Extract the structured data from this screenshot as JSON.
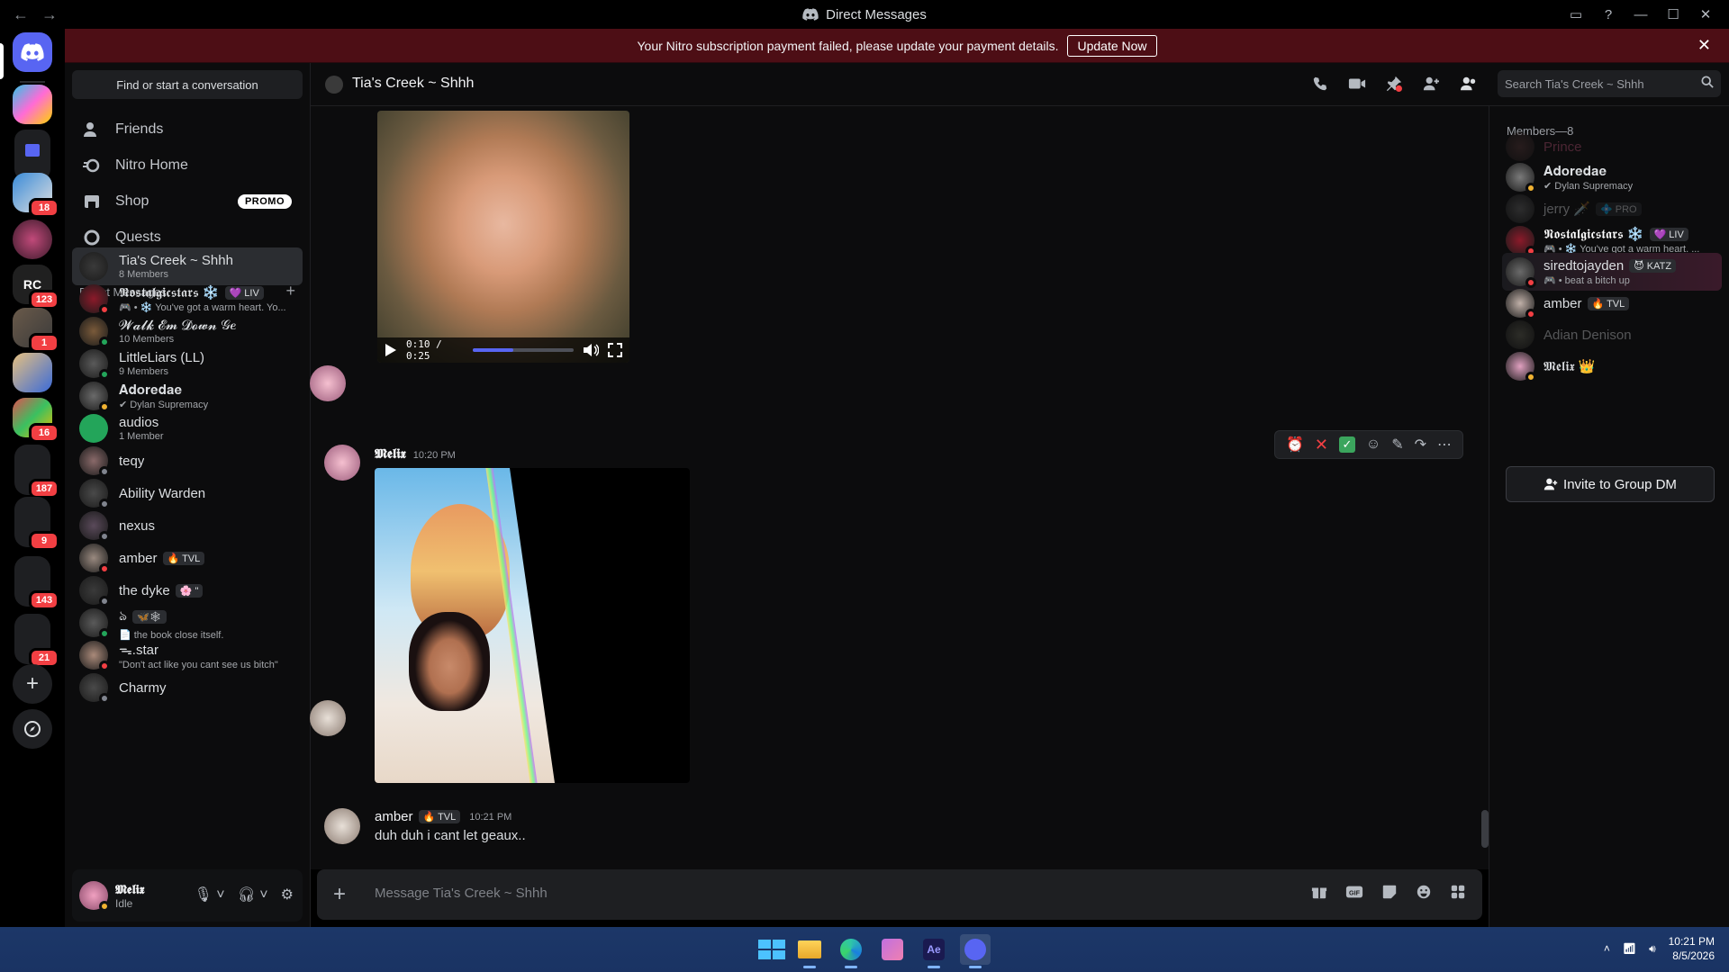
{
  "window": {
    "title": "Direct Messages"
  },
  "banner": {
    "text": "Your Nitro subscription payment failed, please update your payment details.",
    "button": "Update Now"
  },
  "servers": [
    {
      "badge": "18"
    },
    {
      "badge": ""
    },
    {
      "badge": "123"
    },
    {
      "badge": "1"
    },
    {
      "badge": ""
    },
    {
      "badge": "16"
    },
    {
      "badge": "187"
    },
    {
      "badge": "9"
    },
    {
      "badge": "143"
    },
    {
      "badge": "21"
    }
  ],
  "sidebar": {
    "find_placeholder": "Find or start a conversation",
    "nav": [
      {
        "label": "Friends"
      },
      {
        "label": "Nitro Home"
      },
      {
        "label": "Shop",
        "badge": "PROMO"
      },
      {
        "label": "Quests"
      }
    ],
    "dm_header": "Direct Messages",
    "dms": [
      {
        "name": "Tia's Creek ~ Shhh",
        "sub": "8 Members",
        "color": "#3a3a3a"
      },
      {
        "name": "𝕹𝖔𝖘𝖙𝖆𝖑𝖌𝖎𝖈𝖘𝖙𝖆𝖗𝖘 ❄️",
        "tag": "💜 LIV",
        "sub": "🎮 • ❄️ You've got a warm heart. Yo...",
        "color": "#8c1a2a"
      },
      {
        "name": "𝓦𝓪𝓵𝓴 𝓔𝓶 𝓓𝓸𝔀𝓷 𝒢𝒆",
        "sub": "10 Members",
        "color": "#7a5a3a"
      },
      {
        "name": "LittleLiars (LL)",
        "sub": "9 Members",
        "color": "#5a5a5a"
      },
      {
        "name": "𝐀𝐝𝐨𝐫𝐞𝐝𝐚𝐞",
        "sub": "✔ Dylan Supremacy",
        "color": "#6a6a6a"
      },
      {
        "name": "audios",
        "sub": "1 Member",
        "color": "#23a55a"
      },
      {
        "name": "teqy",
        "sub": "",
        "color": "#8a6a6a"
      },
      {
        "name": "Ability Warden",
        "sub": "",
        "color": "#4a4a4a"
      },
      {
        "name": "nexus",
        "sub": "",
        "color": "#5a4a5a"
      },
      {
        "name": "amber",
        "tag": "🔥 TVL",
        "sub": "",
        "color": "#9a8a80"
      },
      {
        "name": "the dyke",
        "tag": "🌸 \"",
        "sub": "",
        "color": "#3a3a3a"
      },
      {
        "name": "ঌ",
        "tag": "🦋🕸",
        "sub": "📄 the book close itself.",
        "color": "#5a5a5a"
      },
      {
        "name": "ᯓ.star",
        "sub": "\"Don't act like you cant see us bitch\"",
        "color": "#aa8a7a"
      },
      {
        "name": "Charmy",
        "sub": "",
        "color": "#4a4a4a"
      }
    ]
  },
  "user": {
    "name": "𝕸𝖊𝖑𝖎𝖝",
    "status": "Idle"
  },
  "channel": {
    "name": "Tia's Creek ~ Shhh",
    "search_placeholder": "Search Tia's Creek ~ Shhh"
  },
  "video": {
    "time": "0:10 / 0:25",
    "progress": 0.4
  },
  "messages": [
    {
      "author": "𝕸𝖊𝖑𝖎𝖝",
      "time": "10:20 PM"
    },
    {
      "author": "amber",
      "tag": "🔥 TVL",
      "time": "10:21 PM",
      "text": "duh duh i cant let geaux.."
    }
  ],
  "composer": {
    "placeholder": "Message Tia's Creek ~ Shhh"
  },
  "members": {
    "header": "Members—8",
    "list": [
      {
        "name": "Prince",
        "sub": "",
        "offline": true,
        "color": "#c0557a"
      },
      {
        "name": "𝐀𝐝𝐨𝐫𝐞𝐝𝐚𝐞",
        "sub": "✔ Dylan Supremacy",
        "offline": false,
        "color": "#dbdee1"
      },
      {
        "name": "jerry 🗡️",
        "tag": "💠 PRO",
        "sub": "",
        "offline": true,
        "color": "#dbdee1"
      },
      {
        "name": "𝕹𝖔𝖘𝖙𝖆𝖑𝖌𝖎𝖈𝖘𝖙𝖆𝖗𝖘 ❄️",
        "tag": "💜 LIV",
        "sub": "🎮 • ❄️ You've got a warm heart. ...",
        "offline": false,
        "color": "#ffffff"
      },
      {
        "name": "siredtojayden",
        "tag": "😈 KATZ",
        "sub": "🎮 • beat a bitch up",
        "offline": false,
        "color": "#dbdee1"
      },
      {
        "name": "amber",
        "tag": "🔥 TVL",
        "sub": "",
        "offline": false,
        "color": "#dbdee1"
      },
      {
        "name": "Adian Denison",
        "sub": "",
        "offline": true,
        "color": "#dbdee1"
      },
      {
        "name": "𝕸𝖊𝖑𝖎𝖝 👑",
        "sub": "",
        "offline": false,
        "color": "#dbdee1"
      }
    ],
    "invite": "Invite to Group DM"
  },
  "taskbar": {
    "time": "10:21 PM",
    "date": "8/5/2026"
  }
}
